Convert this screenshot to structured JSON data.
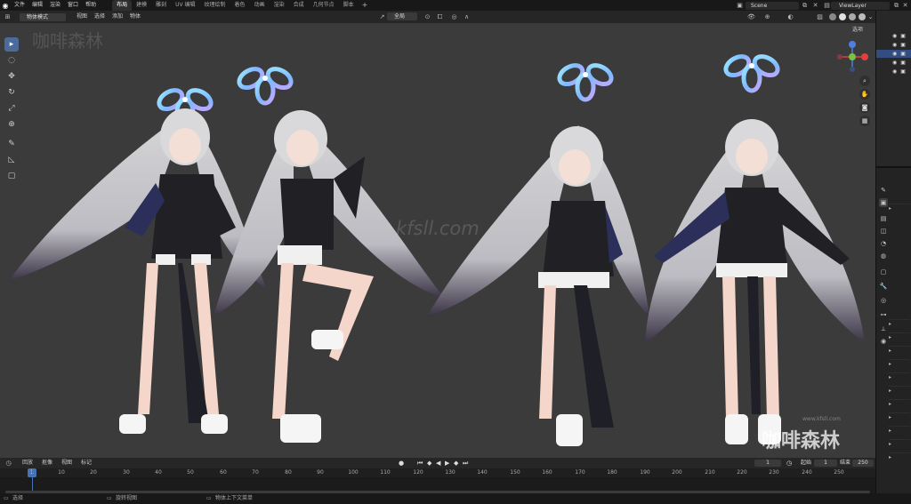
{
  "topbar": {
    "menus": [
      "文件",
      "编辑",
      "渲染",
      "窗口",
      "帮助"
    ],
    "workspaces": [
      "布局",
      "建模",
      "雕刻",
      "UV 编辑",
      "纹理绘制",
      "着色",
      "动画",
      "渲染",
      "合成",
      "几何节点",
      "脚本"
    ],
    "active_workspace_index": 0,
    "scene": "Scene",
    "viewlayer": "ViewLayer"
  },
  "viewport_header": {
    "mode": "物体模式",
    "menus": [
      "视图",
      "选择",
      "添加",
      "物体"
    ],
    "transform_orientation": "全局",
    "options": "选项"
  },
  "toolbar": {
    "tools": [
      "select-box-icon",
      "cursor-icon",
      "move-icon",
      "rotate-icon",
      "scale-icon",
      "transform-icon",
      "annotate-icon",
      "measure-icon",
      "add-cube-icon"
    ]
  },
  "viewport": {
    "watermark_top": "咖啡森林",
    "watermark_mid": "kfsll.com",
    "watermark_url": "www.kfsll.com",
    "watermark_logo": "咖啡森林"
  },
  "timeline": {
    "menus": [
      "回放",
      "抠像",
      "视图",
      "标记"
    ],
    "current_frame": "1",
    "start_label": "起始",
    "start": "1",
    "end_label": "结束",
    "end": "250",
    "current_field": "1",
    "ticks": [
      "10",
      "20",
      "30",
      "40",
      "50",
      "60",
      "70",
      "80",
      "90",
      "100",
      "110",
      "120",
      "130",
      "140",
      "150",
      "160",
      "170",
      "180",
      "190",
      "200",
      "210",
      "220",
      "230",
      "240",
      "250"
    ]
  },
  "statusbar": {
    "items": [
      "选择",
      "旋转视图",
      "物体上下文菜单"
    ]
  },
  "colors": {
    "accent": "#4772b3",
    "viewport_bg": "#3b3b3b",
    "selection": "#334d80"
  }
}
